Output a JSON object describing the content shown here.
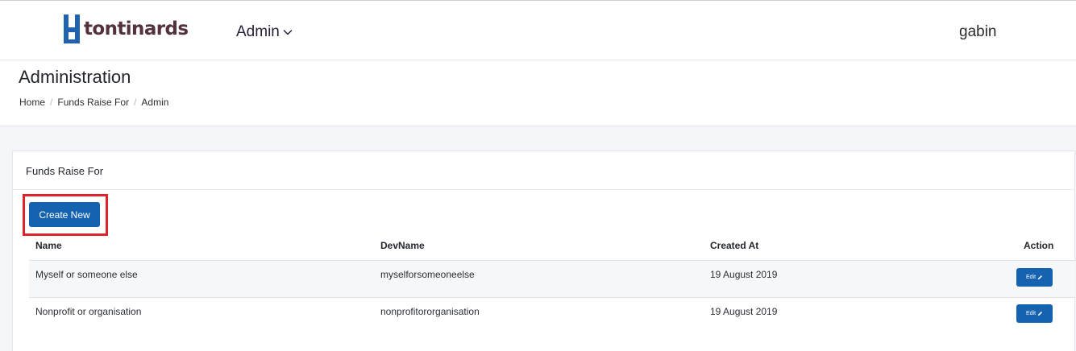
{
  "brand": {
    "name": "tontinards",
    "color": "#1f62ad",
    "text_color": "#54323d"
  },
  "nav": {
    "admin_label": "Admin",
    "user": "gabin"
  },
  "page": {
    "title": "Administration",
    "breadcrumb": [
      "Home",
      "Funds Raise For",
      "Admin"
    ]
  },
  "card": {
    "title": "Funds Raise For",
    "create_label": "Create New",
    "columns": [
      "Name",
      "DevName",
      "Created At",
      "Action"
    ],
    "rows": [
      {
        "name": "Myself or someone else",
        "devname": "myselforsomeoneelse",
        "created_at": "19 August 2019",
        "action": "Edit"
      },
      {
        "name": "Nonprofit or organisation",
        "devname": "nonprofitororganisation",
        "created_at": "19 August 2019",
        "action": "Edit"
      }
    ]
  },
  "colors": {
    "primary": "#1563b0",
    "highlight": "#e0232b"
  }
}
